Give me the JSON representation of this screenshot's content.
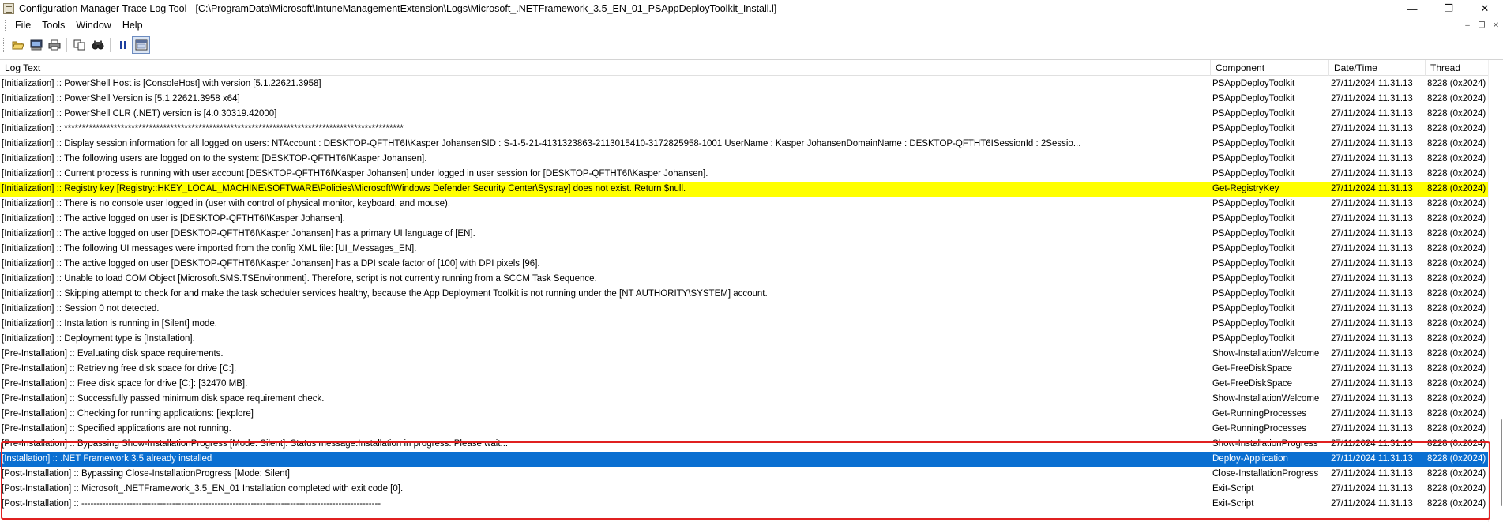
{
  "window": {
    "title": "Configuration Manager Trace Log Tool - [C:\\ProgramData\\Microsoft\\IntuneManagementExtension\\Logs\\Microsoft_.NETFramework_3.5_EN_01_PSAppDeployToolkit_Install.l]",
    "minimize": "—",
    "maximize": "❐",
    "close": "✕"
  },
  "menu": {
    "items": [
      "File",
      "Tools",
      "Window",
      "Help"
    ],
    "mdi_minimize": "‒",
    "mdi_restore": "❐",
    "mdi_close": "✕"
  },
  "toolbar": {
    "icons": [
      "open-folder-icon",
      "open-log-icon",
      "print-icon",
      "copy-icon",
      "find-icon",
      "pause-icon",
      "view-detail-icon"
    ]
  },
  "columns": {
    "log_text": "Log Text",
    "component": "Component",
    "datetime": "Date/Time",
    "thread": "Thread"
  },
  "rows": [
    {
      "text": "[Initialization] :: PowerShell Host is [ConsoleHost] with version [5.1.22621.3958]",
      "component": "PSAppDeployToolkit",
      "datetime": "27/11/2024 11.31.13",
      "thread": "8228 (0x2024)",
      "state": "normal"
    },
    {
      "text": "[Initialization] :: PowerShell Version is [5.1.22621.3958 x64]",
      "component": "PSAppDeployToolkit",
      "datetime": "27/11/2024 11.31.13",
      "thread": "8228 (0x2024)",
      "state": "normal"
    },
    {
      "text": "[Initialization] :: PowerShell CLR (.NET) version is [4.0.30319.42000]",
      "component": "PSAppDeployToolkit",
      "datetime": "27/11/2024 11.31.13",
      "thread": "8228 (0x2024)",
      "state": "normal"
    },
    {
      "text": "[Initialization] :: ************************************************************************************************",
      "component": "PSAppDeployToolkit",
      "datetime": "27/11/2024 11.31.13",
      "thread": "8228 (0x2024)",
      "state": "normal"
    },
    {
      "text": "[Initialization] :: Display session information for all logged on users:  NTAccount           : DESKTOP-QFTHT6I\\Kasper JohansenSID               : S-1-5-21-4131323863-2113015410-3172825958-1001 UserName           : Kasper JohansenDomainName          : DESKTOP-QFTHT6ISessionId           : 2Sessio...",
      "component": "PSAppDeployToolkit",
      "datetime": "27/11/2024 11.31.13",
      "thread": "8228 (0x2024)",
      "state": "normal"
    },
    {
      "text": "[Initialization] :: The following users are logged on to the system: [DESKTOP-QFTHT6I\\Kasper Johansen].",
      "component": "PSAppDeployToolkit",
      "datetime": "27/11/2024 11.31.13",
      "thread": "8228 (0x2024)",
      "state": "normal"
    },
    {
      "text": "[Initialization] :: Current process is running with user account [DESKTOP-QFTHT6I\\Kasper Johansen] under logged in user session for [DESKTOP-QFTHT6I\\Kasper Johansen].",
      "component": "PSAppDeployToolkit",
      "datetime": "27/11/2024 11.31.13",
      "thread": "8228 (0x2024)",
      "state": "normal"
    },
    {
      "text": "[Initialization] :: Registry key [Registry::HKEY_LOCAL_MACHINE\\SOFTWARE\\Policies\\Microsoft\\Windows Defender Security Center\\Systray] does not exist. Return $null.",
      "component": "Get-RegistryKey",
      "datetime": "27/11/2024 11.31.13",
      "thread": "8228 (0x2024)",
      "state": "warn"
    },
    {
      "text": "[Initialization] :: There is no console user logged in (user with control of physical monitor, keyboard, and mouse).",
      "component": "PSAppDeployToolkit",
      "datetime": "27/11/2024 11.31.13",
      "thread": "8228 (0x2024)",
      "state": "normal"
    },
    {
      "text": "[Initialization] :: The active logged on user is [DESKTOP-QFTHT6I\\Kasper Johansen].",
      "component": "PSAppDeployToolkit",
      "datetime": "27/11/2024 11.31.13",
      "thread": "8228 (0x2024)",
      "state": "normal"
    },
    {
      "text": "[Initialization] :: The active logged on user [DESKTOP-QFTHT6I\\Kasper Johansen] has a primary UI language of [EN].",
      "component": "PSAppDeployToolkit",
      "datetime": "27/11/2024 11.31.13",
      "thread": "8228 (0x2024)",
      "state": "normal"
    },
    {
      "text": "[Initialization] :: The following UI messages were imported from the config XML file: [UI_Messages_EN].",
      "component": "PSAppDeployToolkit",
      "datetime": "27/11/2024 11.31.13",
      "thread": "8228 (0x2024)",
      "state": "normal"
    },
    {
      "text": "[Initialization] :: The active logged on user [DESKTOP-QFTHT6I\\Kasper Johansen] has a DPI scale factor of [100] with DPI pixels [96].",
      "component": "PSAppDeployToolkit",
      "datetime": "27/11/2024 11.31.13",
      "thread": "8228 (0x2024)",
      "state": "normal"
    },
    {
      "text": "[Initialization] :: Unable to load COM Object [Microsoft.SMS.TSEnvironment]. Therefore, script is not currently running from a SCCM Task Sequence.",
      "component": "PSAppDeployToolkit",
      "datetime": "27/11/2024 11.31.13",
      "thread": "8228 (0x2024)",
      "state": "normal"
    },
    {
      "text": "[Initialization] :: Skipping attempt to check for and make the task scheduler services healthy, because the App Deployment Toolkit is not running under the [NT AUTHORITY\\SYSTEM] account.",
      "component": "PSAppDeployToolkit",
      "datetime": "27/11/2024 11.31.13",
      "thread": "8228 (0x2024)",
      "state": "normal"
    },
    {
      "text": "[Initialization] :: Session 0 not detected.",
      "component": "PSAppDeployToolkit",
      "datetime": "27/11/2024 11.31.13",
      "thread": "8228 (0x2024)",
      "state": "normal"
    },
    {
      "text": "[Initialization] :: Installation is running in [Silent] mode.",
      "component": "PSAppDeployToolkit",
      "datetime": "27/11/2024 11.31.13",
      "thread": "8228 (0x2024)",
      "state": "normal"
    },
    {
      "text": "[Initialization] :: Deployment type is [Installation].",
      "component": "PSAppDeployToolkit",
      "datetime": "27/11/2024 11.31.13",
      "thread": "8228 (0x2024)",
      "state": "normal"
    },
    {
      "text": "[Pre-Installation] :: Evaluating disk space requirements.",
      "component": "Show-InstallationWelcome",
      "datetime": "27/11/2024 11.31.13",
      "thread": "8228 (0x2024)",
      "state": "normal"
    },
    {
      "text": "[Pre-Installation] :: Retrieving free disk space for drive [C:].",
      "component": "Get-FreeDiskSpace",
      "datetime": "27/11/2024 11.31.13",
      "thread": "8228 (0x2024)",
      "state": "normal"
    },
    {
      "text": "[Pre-Installation] :: Free disk space for drive [C:]: [32470 MB].",
      "component": "Get-FreeDiskSpace",
      "datetime": "27/11/2024 11.31.13",
      "thread": "8228 (0x2024)",
      "state": "normal"
    },
    {
      "text": "[Pre-Installation] :: Successfully passed minimum disk space requirement check.",
      "component": "Show-InstallationWelcome",
      "datetime": "27/11/2024 11.31.13",
      "thread": "8228 (0x2024)",
      "state": "normal"
    },
    {
      "text": "[Pre-Installation] :: Checking for running applications: [iexplore]",
      "component": "Get-RunningProcesses",
      "datetime": "27/11/2024 11.31.13",
      "thread": "8228 (0x2024)",
      "state": "normal"
    },
    {
      "text": "[Pre-Installation] :: Specified applications are not running.",
      "component": "Get-RunningProcesses",
      "datetime": "27/11/2024 11.31.13",
      "thread": "8228 (0x2024)",
      "state": "normal"
    },
    {
      "text": "[Pre-Installation] :: Bypassing Show-InstallationProgress [Mode: Silent]. Status message:Installation in progress. Please wait...",
      "component": "Show-InstallationProgress",
      "datetime": "27/11/2024 11.31.13",
      "thread": "8228 (0x2024)",
      "state": "normal"
    },
    {
      "text": "[Installation] :: .NET Framework 3.5 already installed",
      "component": "Deploy-Application",
      "datetime": "27/11/2024 11.31.13",
      "thread": "8228 (0x2024)",
      "state": "sel"
    },
    {
      "text": "[Post-Installation] :: Bypassing Close-InstallationProgress [Mode: Silent]",
      "component": "Close-InstallationProgress",
      "datetime": "27/11/2024 11.31.13",
      "thread": "8228 (0x2024)",
      "state": "normal"
    },
    {
      "text": "[Post-Installation] :: Microsoft_.NETFramework_3.5_EN_01 Installation completed with exit code [0].",
      "component": "Exit-Script",
      "datetime": "27/11/2024 11.31.13",
      "thread": "8228 (0x2024)",
      "state": "normal"
    },
    {
      "text": "[Post-Installation] :: ---------------------------------------------------------------------------------------------------",
      "component": "Exit-Script",
      "datetime": "27/11/2024 11.31.13",
      "thread": "8228 (0x2024)",
      "state": "normal"
    }
  ],
  "colors": {
    "warning_row": "#ffff00",
    "selected_row": "#0a6fd1",
    "annotation_box": "#e02020"
  }
}
